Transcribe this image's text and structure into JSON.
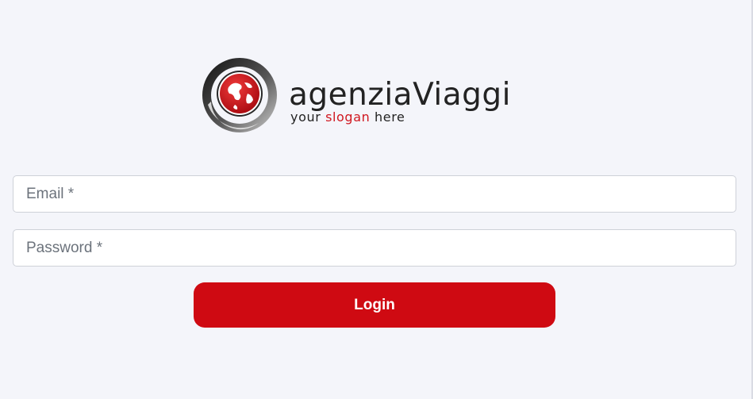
{
  "logo": {
    "brand": "agenziaViaggi",
    "slogan_prefix": "your ",
    "slogan_accent": "slogan",
    "slogan_suffix": " here",
    "colors": {
      "accent": "#d0171f",
      "text": "#232323"
    },
    "icon": "globe-swirl-icon"
  },
  "form": {
    "email_placeholder": "Email *",
    "email_value": "",
    "password_placeholder": "Password *",
    "password_value": "",
    "login_label": "Login"
  },
  "colors": {
    "background": "#f4f5fa",
    "button": "#cf0a12",
    "button_text": "#ffffff",
    "field_border": "#ced1d8"
  }
}
